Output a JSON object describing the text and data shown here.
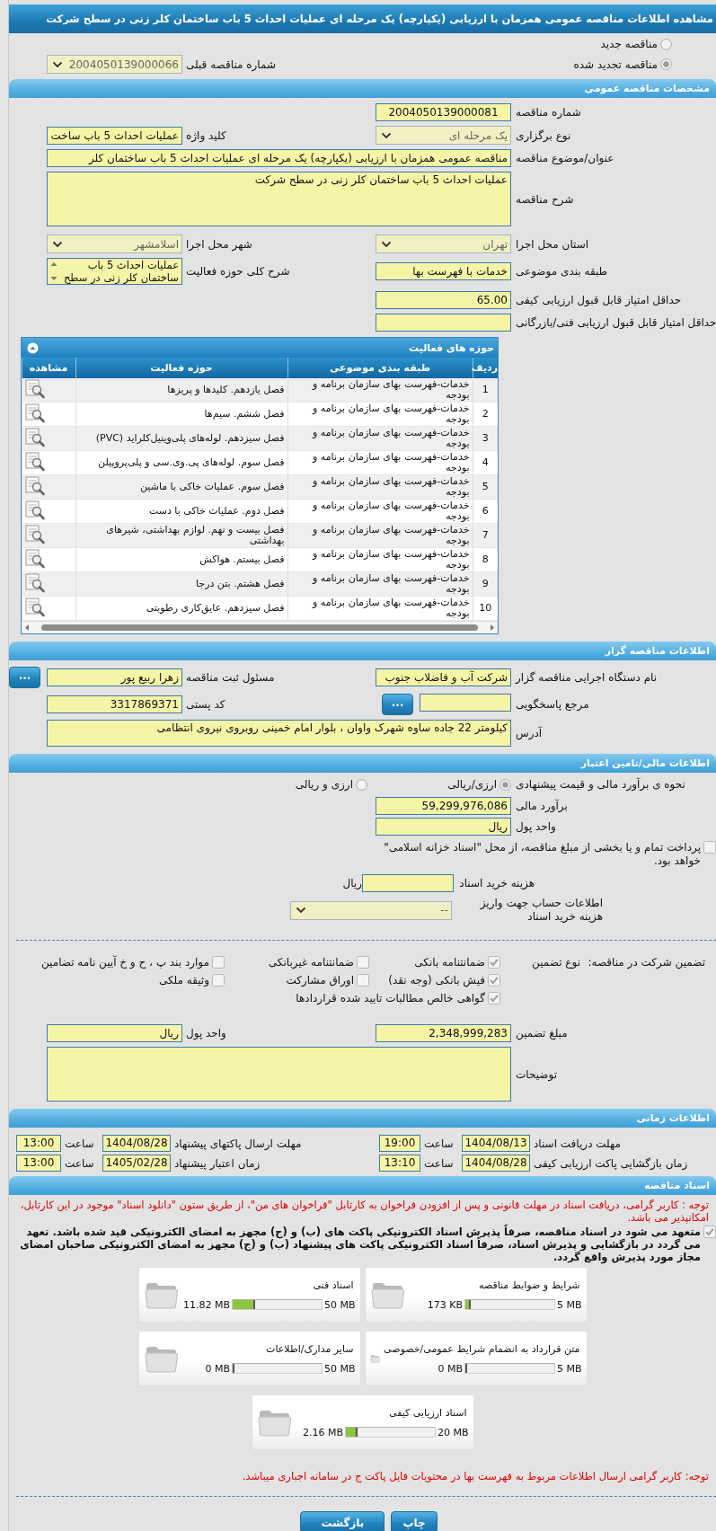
{
  "title": "مشاهده اطلاعات مناقصه عمومی همزمان با ارزیابی (یکپارچه) یک مرحله ای عملیات احداث 5 باب ساختمان کلر زنی در سطح شرکت",
  "tender_type": [
    {
      "label": "مناقصه جدید",
      "selected": false
    },
    {
      "label": "مناقصه تجدید شده",
      "selected": true
    }
  ],
  "previous_tender": {
    "label": "شماره مناقصه قبلی",
    "value": "2004050139000066",
    "kind": "select",
    "disabled": true
  },
  "general": {
    "title": "مشخصات مناقصه عمومی",
    "rows": [
      {
        "fields": [
          {
            "label": "شماره مناقصه",
            "value": "2004050139000081",
            "kind": "code"
          }
        ]
      },
      {
        "fields": [
          {
            "label": "نوع برگزاری",
            "value": "یک مرحله ای",
            "kind": "select",
            "disabled": true
          },
          {
            "label": "کلید واژه",
            "value": "عملیات احداث 5 باب ساخت",
            "kind": "input"
          }
        ]
      },
      {
        "fields": [
          {
            "label": "عنوان/موضوع مناقصه",
            "value": "مناقصه عمومی همزمان با ارزیابی (یکپارچه) یک مرحله ای عملیات احداث 5 باب ساختمان کلر",
            "kind": "wide"
          }
        ]
      },
      {
        "fields": [
          {
            "label": "شرح مناقصه",
            "value": "عملیات احداث 5 باب ساختمان کلر زنی در سطح شرکت",
            "kind": "textarea"
          }
        ]
      },
      {
        "fields": [
          {
            "label": "استان محل اجرا",
            "value": "تهران",
            "kind": "select",
            "disabled": true
          },
          {
            "label": "شهر محل اجرا",
            "value": "اسلامشهر",
            "kind": "select",
            "disabled": true
          }
        ]
      },
      {
        "fields": [
          {
            "label": "طبقه بندی موضوعی",
            "value": "خدمات با فهرست بها",
            "kind": "input"
          },
          {
            "label": "شرح کلی حوزه فعالیت",
            "value": "عملیات احداث 5 باب ساختمان کلر زنی در سطح",
            "kind": "listbox"
          }
        ]
      },
      {
        "fields": [
          {
            "label": "حداقل امتیاز قابل قبول ارزیابی کیفی",
            "value": "65.00",
            "kind": "input"
          }
        ]
      },
      {
        "fields": [
          {
            "label": "حداقل امتیاز قابل قبول ارزیابی فنی/بازرگانی",
            "kind": "input"
          }
        ]
      }
    ]
  },
  "activities": {
    "title": "حوزه های فعالیت",
    "columns": [
      "ردیف",
      "طبقه بندی موضوعی",
      "حوزه فعالیت",
      "مشاهده"
    ],
    "rows": [
      {
        "number": "1",
        "category": "خدمات-فهرست بهای سازمان برنامه و بودجه",
        "activity": "فصل یازدهم. کلیدها و پریزها"
      },
      {
        "number": "2",
        "category": "خدمات-فهرست بهای سازمان برنامه و بودجه",
        "activity": "فصل ششم. سیم‌ها"
      },
      {
        "number": "3",
        "category": "خدمات-فهرست بهای سازمان برنامه و بودجه",
        "activity": "فصل سیزدهم. لوله‌های پلی‌وینیل‌کلراید (PVC)"
      },
      {
        "number": "4",
        "category": "خدمات-فهرست بهای سازمان برنامه و بودجه",
        "activity": "فصل سوم. لوله‌های پی.وی.سی و پلی‌پروپیلن"
      },
      {
        "number": "5",
        "category": "خدمات-فهرست بهای سازمان برنامه و بودجه",
        "activity": "فصل سوم. عملیات خاکی با ماشین"
      },
      {
        "number": "6",
        "category": "خدمات-فهرست بهای سازمان برنامه و بودجه",
        "activity": "فصل دوم. عملیات خاکی با دست"
      },
      {
        "number": "7",
        "category": "خدمات-فهرست بهای سازمان برنامه و بودجه",
        "activity": "فصل بیست و نهم. لوازم بهداشتی، شیرهای بهداشتی"
      },
      {
        "number": "8",
        "category": "خدمات-فهرست بهای سازمان برنامه و بودجه",
        "activity": "فصل بیستم. هواکش"
      },
      {
        "number": "9",
        "category": "خدمات-فهرست بهای سازمان برنامه و بودجه",
        "activity": "فصل هشتم. بتن درجا"
      },
      {
        "number": "10",
        "category": "خدمات-فهرست بهای سازمان برنامه و بودجه",
        "activity": "فصل سیزدهم. عایق‌کاری رطوبتی"
      }
    ]
  },
  "organizer": {
    "title": "اطلاعات مناقصه گزار",
    "rows": [
      {
        "fields": [
          {
            "label": "نام دستگاه اجرایی مناقصه گزار",
            "value": "شرکت آب و فاضلاب جنوب",
            "kind": "input"
          },
          {
            "label": "مسئول ثبت مناقصه",
            "value": "زهرا ربیع پور",
            "kind": "input",
            "button": "..."
          }
        ]
      },
      {
        "fields": [
          {
            "label": "مرجع پاسخگویی",
            "kind": "input",
            "button": "..."
          },
          {
            "label": "کد پستی",
            "value": "3317869371",
            "kind": "input"
          }
        ]
      },
      {
        "fields": [
          {
            "label": "آدرس",
            "value": "کیلومتر 22 جاده ساوه شهرک واوان ، بلوار امام خمینی  روبروی نیروی انتظامی",
            "kind": "address"
          }
        ]
      }
    ]
  },
  "financial": {
    "title": "اطلاعات مالی/تامین اعتبار",
    "estimate_method": {
      "label": "نحوه ی برآورد مالی و قیمت پیشنهادی",
      "options": [
        {
          "label": "ارزی/ریالی",
          "selected": true
        },
        {
          "label": "ارزی و ریالی",
          "selected": false
        }
      ]
    },
    "estimate": {
      "label": "برآورد مالی",
      "value": "59,299,976,086"
    },
    "currency": {
      "label": "واحد پول",
      "value": "ریال"
    },
    "treasury": {
      "label": "پرداخت تمام و یا بخشی از مبلغ مناقصه، از محل \"اسناد خزانه اسلامی\" خواهد بود.",
      "checked": false
    },
    "document_fee": {
      "label": "هزینه خرید اسناد",
      "unit": "ریال"
    },
    "fee_account": {
      "label": "اطلاعات حساب جهت واریز هزینه خرید اسناد",
      "value": "--",
      "kind": "select",
      "disabled": true
    },
    "guarantee": {
      "label": "تضمین شرکت در مناقصه:",
      "type_label": "نوع تضمین",
      "options": [
        {
          "label": "ضمانتنامه بانکی",
          "checked": true
        },
        {
          "label": "ضمانتنامه غیربانکی",
          "checked": false
        },
        {
          "label": "موارد بند پ ، ح و خ آیین نامه تضامین",
          "checked": false
        },
        {
          "label": "فیش بانکی (وجه نقد)",
          "checked": true
        },
        {
          "label": "اوراق مشارکت",
          "checked": false
        },
        {
          "label": "وثیقه ملکی",
          "checked": false
        },
        {
          "label": "گواهی خالص مطالبات تایید شده قراردادها",
          "checked": true
        }
      ]
    },
    "rows": [
      {
        "fields": [
          {
            "label": "مبلغ تضمین",
            "value": "2,348,999,283",
            "kind": "input"
          },
          {
            "label": "واحد پول",
            "value": "ریال",
            "kind": "input"
          }
        ]
      },
      {
        "fields": [
          {
            "label": "توضیحات",
            "kind": "textarea"
          }
        ]
      }
    ]
  },
  "timing": {
    "title": "اطلاعات زمانی",
    "rows": [
      [
        {
          "label": "مهلت دریافت اسناد",
          "date": "1404/08/13",
          "time_label": "ساعت",
          "time": "19:00"
        },
        {
          "label": "مهلت ارسال پاکتهای پیشنهاد",
          "date": "1404/08/28",
          "time_label": "ساعت",
          "time": "13:00"
        }
      ],
      [
        {
          "label": "زمان بازگشایی پاکت ارزیابی کیفی",
          "date": "1404/08/28",
          "time_label": "ساعت",
          "time": "13:10"
        },
        {
          "label": "زمان اعتبار پیشنهاد",
          "date": "1405/02/28",
          "time_label": "ساعت",
          "time": "13:00"
        }
      ]
    ]
  },
  "documents": {
    "title": "اسناد مناقصه",
    "notice": "توجه : کاربر گرامی، دریافت اسناد در مهلت قانونی و پس از افزودن فراخوان به کارتابل \"فراخوان های من\"، از طریق ستون \"دانلود اسناد\" موجود در این کارتابل، امکانپذیر می باشد.",
    "commitment": {
      "text": "متعهد می شود در اسناد مناقصه، صرفاً پذیرش اسناد الکترونیکی پاکت های (ب) و (ج) مجهز به امضای الکترونیکی قید شده باشد. تعهد می گردد در بازگشایی و پذیرش اسناد، صرفاً اسناد الکترونیکی پاکت های پیشنهاد (ب) و (ج) مجهز به امضای الکترونیکی صاحبان امضای مجاز مورد پذیرش واقع گردد.",
      "checked": true
    },
    "files": [
      {
        "title": "شرایط و ضوابط مناقصه",
        "used": "173 KB",
        "max": "5 MB",
        "level": 0.04
      },
      {
        "title": "اسناد فنی",
        "used": "11.82 MB",
        "max": "50 MB",
        "level": 0.24
      },
      {
        "title": "متن قرارداد به انضمام شرایط عمومی/خصوصی",
        "used": "0 MB",
        "max": "5 MB",
        "level": 0
      },
      {
        "title": "سایر مدارک/اطلاعات",
        "used": "0 MB",
        "max": "50 MB",
        "level": 0
      },
      {
        "title": "اسناد ارزیابی کیفی",
        "used": "2.16 MB",
        "max": "20 MB",
        "level": 0.11
      }
    ],
    "note": "توجه: کاربر گرامی ارسال اطلاعات مربوط به فهرست بها در محتویات فایل پاکت ج در سامانه اجباری میباشد."
  },
  "buttons": [
    "چاپ",
    "بازگشت"
  ]
}
